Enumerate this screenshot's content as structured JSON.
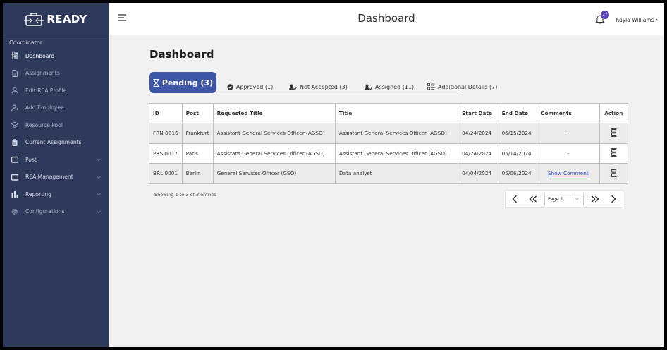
{
  "app": {
    "name": "READY",
    "role": "Coordinator"
  },
  "sidebar": {
    "items": [
      {
        "label": "Dashboard",
        "icon": "sliders-icon",
        "active": true
      },
      {
        "label": "Assignments",
        "icon": "document-icon"
      },
      {
        "label": "Edit REA Profile",
        "icon": "user-icon"
      },
      {
        "label": "Add Employee",
        "icon": "user-add-icon"
      },
      {
        "label": "Resource Pool",
        "icon": "layers-icon"
      },
      {
        "label": "Current Assignments",
        "icon": "clipboard-icon"
      },
      {
        "label": "Post",
        "icon": "inbox-icon",
        "expandable": true
      },
      {
        "label": "REA Management",
        "icon": "inbox-icon",
        "expandable": true
      },
      {
        "label": "Reporting",
        "icon": "bar-chart-icon",
        "expandable": true
      },
      {
        "label": "Configurations",
        "icon": "gear-icon",
        "expandable": true
      }
    ]
  },
  "header": {
    "title": "Dashboard",
    "notification_count": "27",
    "user_name": "Kayla Williams"
  },
  "main": {
    "title": "Dashboard",
    "tabs": [
      {
        "label": "Pending (3)",
        "active": true
      },
      {
        "label": "Approved (1)"
      },
      {
        "label": "Not Accepted (3)"
      },
      {
        "label": "Assigned (11)"
      },
      {
        "label": "Additional Details (7)"
      }
    ],
    "table": {
      "columns": [
        "ID",
        "Post",
        "Requested Title",
        "Title",
        "Start Date",
        "End Date",
        "Comments",
        "Action"
      ],
      "rows": [
        [
          "FRN 0016",
          "Frankfurt",
          "Assistant General Services Officer (AGSO)",
          "Assistant General Services Officer (AGSO)",
          "04/24/2024",
          "05/15/2024",
          "-",
          ""
        ],
        [
          "PRS 0017",
          "Paris",
          "Assistant General Services Officer (AGSO)",
          "Assistant General Services Officer (AGSO)",
          "04/24/2024",
          "05/14/2024",
          "-",
          ""
        ],
        [
          "BRL 0001",
          "Berlin",
          "General Services Officer (GSO)",
          "Data analyst",
          "04/04/2024",
          "05/06/2024",
          "Show Comment",
          ""
        ]
      ]
    },
    "entries_text": "Showing 1 to 3 of 3 entries",
    "pager": {
      "page_label": "Page 1"
    }
  },
  "colors": {
    "sidebar_bg": "#2e3a5c",
    "accent": "#3d57a6",
    "badge": "#5b3fb5",
    "link": "#2a4bd0"
  }
}
